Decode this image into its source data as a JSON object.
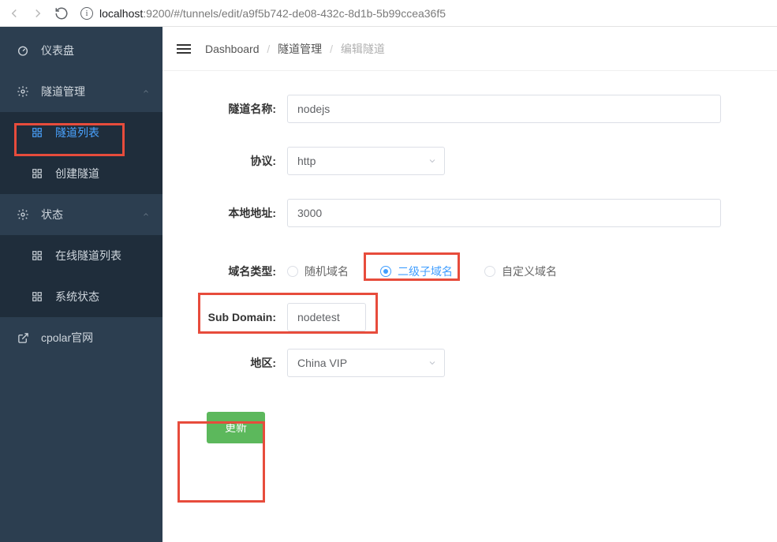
{
  "browser": {
    "url_host": "localhost",
    "url_rest": ":9200/#/tunnels/edit/a9f5b742-de08-432c-8d1b-5b99ccea36f5"
  },
  "sidebar": {
    "dashboard": "仪表盘",
    "tunnel_mgmt": "隧道管理",
    "tunnel_list": "隧道列表",
    "tunnel_create": "创建隧道",
    "status": "状态",
    "online_list": "在线隧道列表",
    "sys_status": "系统状态",
    "cpolar_site": "cpolar官网"
  },
  "breadcrumb": {
    "dashboard": "Dashboard",
    "tunnel_mgmt": "隧道管理",
    "edit_tunnel": "编辑隧道"
  },
  "form": {
    "name_label": "隧道名称:",
    "name_value": "nodejs",
    "proto_label": "协议:",
    "proto_value": "http",
    "local_label": "本地地址:",
    "local_value": "3000",
    "domain_type_label": "域名类型:",
    "domain_random": "随机域名",
    "domain_sub": "二级子域名",
    "domain_custom": "自定义域名",
    "subdomain_label": "Sub Domain:",
    "subdomain_value": "nodetest",
    "region_label": "地区:",
    "region_value": "China VIP",
    "submit": "更新"
  }
}
